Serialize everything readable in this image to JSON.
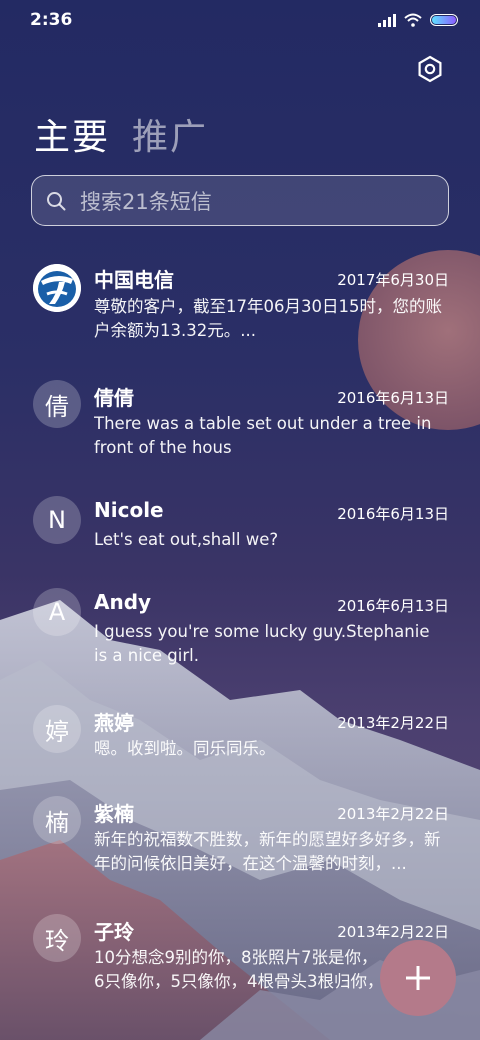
{
  "status_bar": {
    "time": "2:36"
  },
  "tabs": [
    {
      "label": "主要",
      "active": true
    },
    {
      "label": "推广",
      "active": false
    }
  ],
  "search": {
    "placeholder": "搜索21条短信"
  },
  "messages": [
    {
      "name": "中国电信",
      "date": "2017年6月30日",
      "avatar": "",
      "avatar_icon": "china-telecom-logo-icon",
      "preview": "尊敬的客户，截至17年06月30日15时，您的账户余额为13.32元。..."
    },
    {
      "name": "倩倩",
      "date": "2016年6月13日",
      "avatar": "倩",
      "preview": "There was a table set out under a tree in front of the hous"
    },
    {
      "name": "Nicole",
      "date": "2016年6月13日",
      "avatar": "N",
      "preview": "Let's eat out,shall we?"
    },
    {
      "name": "Andy",
      "date": "2016年6月13日",
      "avatar": "A",
      "preview": "I guess you're some lucky guy.Stephanie is a nice girl."
    },
    {
      "name": "燕婷",
      "date": "2013年2月22日",
      "avatar": "婷",
      "preview": "嗯。收到啦。同乐同乐。"
    },
    {
      "name": "紫楠",
      "date": "2013年2月22日",
      "avatar": "楠",
      "preview": "新年的祝福数不胜数，新年的愿望好多好多，新年的问候依旧美好，在这个温馨的时刻，..."
    },
    {
      "name": "子玲",
      "date": "2013年2月22日",
      "avatar": "玲",
      "preview": "10分想念9别的你，8张照片7张是你，6只像你，5只像你，4根骨头3根归你，2爪着地"
    }
  ],
  "colors": {
    "fab": "#b47a8a",
    "accent_battery": "#8b5cff"
  },
  "icons": {
    "settings": "gear-icon",
    "search": "search-icon",
    "fab": "plus-icon"
  }
}
